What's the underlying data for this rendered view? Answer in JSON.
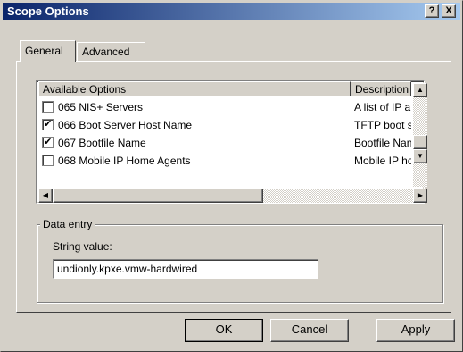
{
  "window": {
    "title": "Scope Options"
  },
  "titlebar": {
    "help_label": "?",
    "close_label": "X"
  },
  "tabs": [
    {
      "label": "General",
      "selected": true
    },
    {
      "label": "Advanced",
      "selected": false
    }
  ],
  "options_list": {
    "headers": [
      "Available Options",
      "Description"
    ],
    "rows": [
      {
        "name": "065 NIS+ Servers",
        "desc": "A list of IP a",
        "checked": false
      },
      {
        "name": "066 Boot Server Host Name",
        "desc": "TFTP boot s",
        "checked": true
      },
      {
        "name": "067 Bootfile Name",
        "desc": "Bootfile Nan",
        "checked": true
      },
      {
        "name": "068 Mobile IP Home Agents",
        "desc": "Mobile IP ho",
        "checked": false
      }
    ]
  },
  "scroll_icons": {
    "up": "▲",
    "down": "▼",
    "left": "◀",
    "right": "▶"
  },
  "data_entry": {
    "group_label": "Data entry",
    "string_label": "String value:",
    "string_value": "undionly.kpxe.vmw-hardwired"
  },
  "buttons": {
    "ok": "OK",
    "cancel": "Cancel",
    "apply": "Apply"
  }
}
